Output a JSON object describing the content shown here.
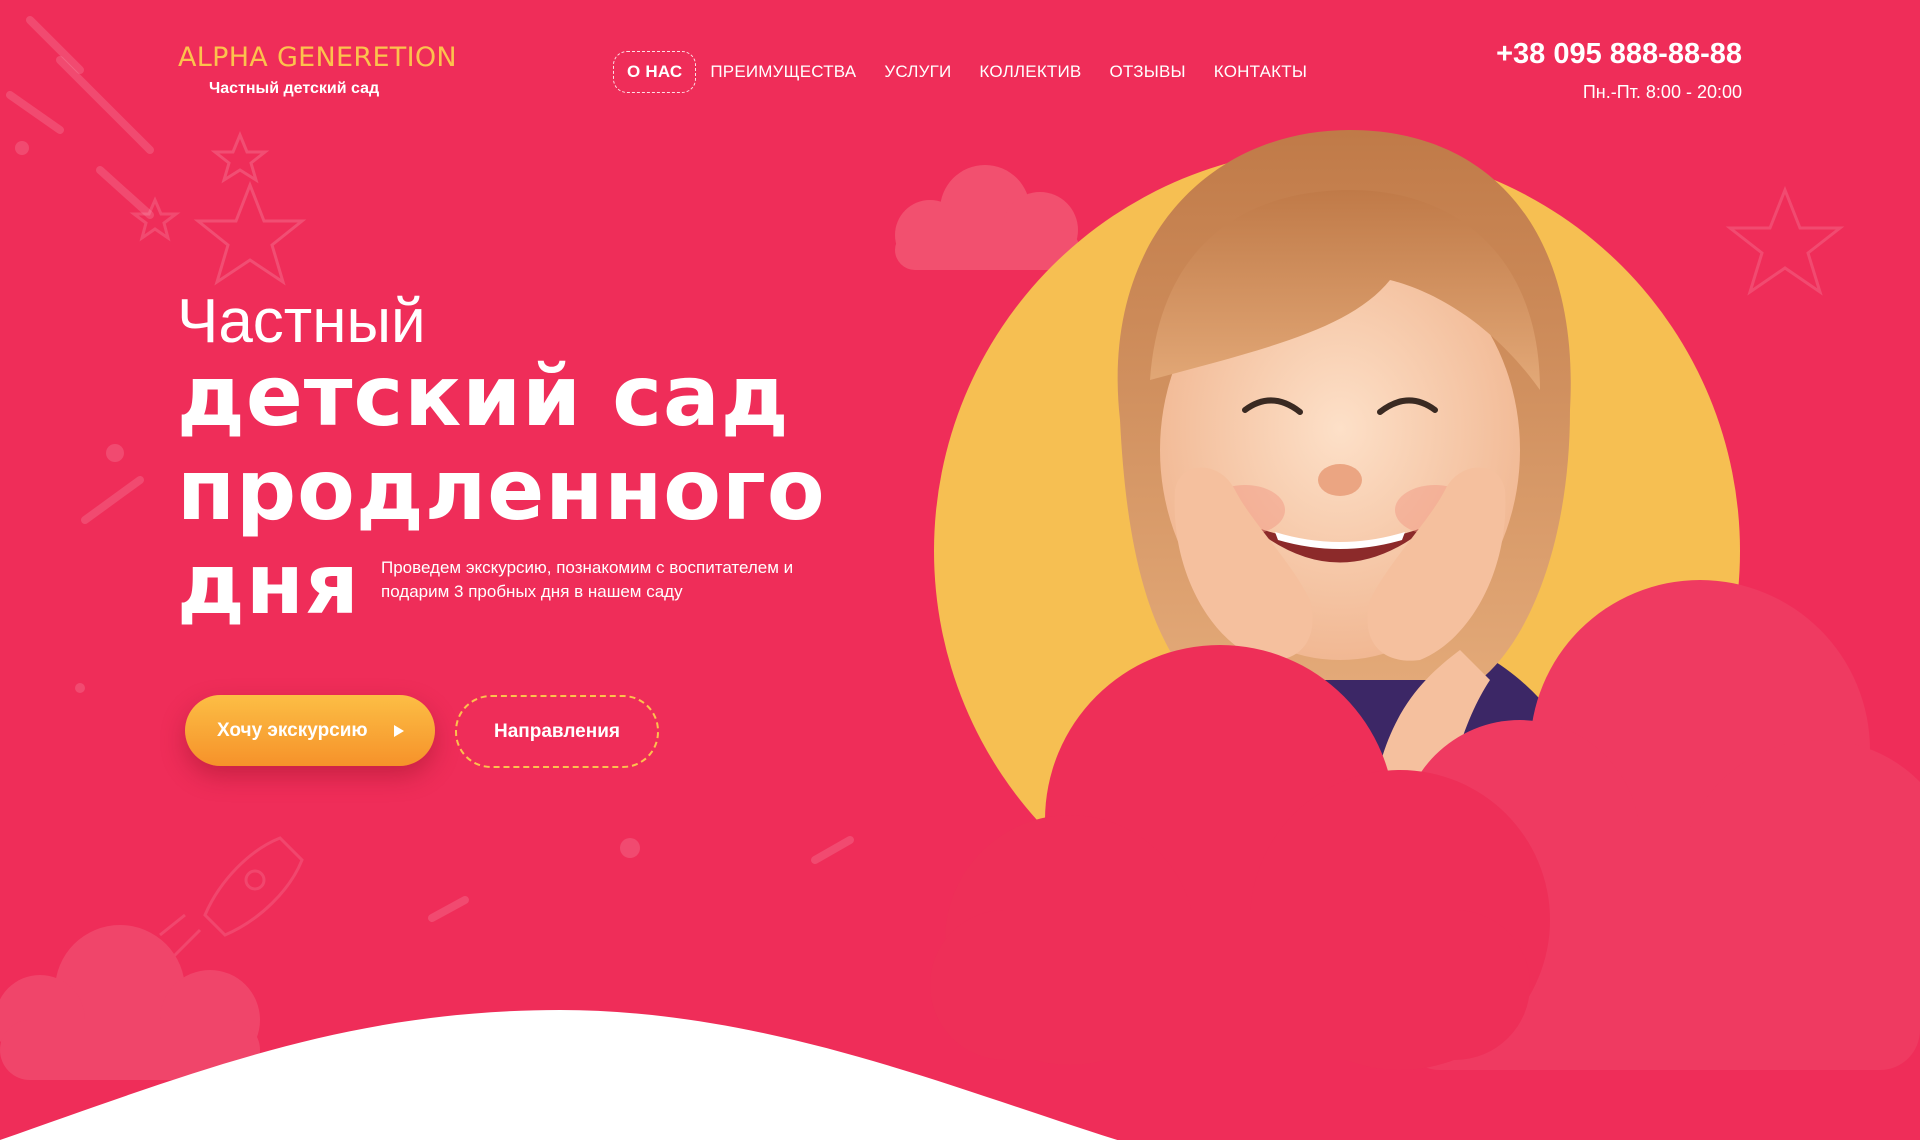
{
  "header": {
    "logo_title": "ALPHA GENERETION",
    "logo_subtitle": "Частный детский сад",
    "nav": [
      {
        "label": "О НАС",
        "active": true
      },
      {
        "label": "ПРЕИМУЩЕСТВА",
        "active": false
      },
      {
        "label": "УСЛУГИ",
        "active": false
      },
      {
        "label": "КОЛЛЕКТИВ",
        "active": false
      },
      {
        "label": "ОТЗЫВЫ",
        "active": false
      },
      {
        "label": "КОНТАКТЫ",
        "active": false
      }
    ],
    "phone": "+38 095 888-88-88",
    "hours": "Пн.-Пт. 8:00 - 20:00"
  },
  "hero": {
    "title_line1": "Частный",
    "title_line2": "детский сад",
    "title_line3": "продленного",
    "title_line4": "дня",
    "subtitle": "Проведем экскурсию, познакомим с воспитателем и подарим 3 пробных дня в нашем саду",
    "primary_button": "Хочу экскурсию",
    "secondary_button": "Направления"
  },
  "colors": {
    "background": "#ef2d59",
    "accent_yellow": "#f6bf52",
    "logo": "#fcc24d",
    "button_orange": "#f9a234",
    "footer_white": "#ffffff"
  },
  "icons": [
    "star-icon",
    "rocket-icon",
    "play-arrow-icon",
    "cloud-icon"
  ]
}
